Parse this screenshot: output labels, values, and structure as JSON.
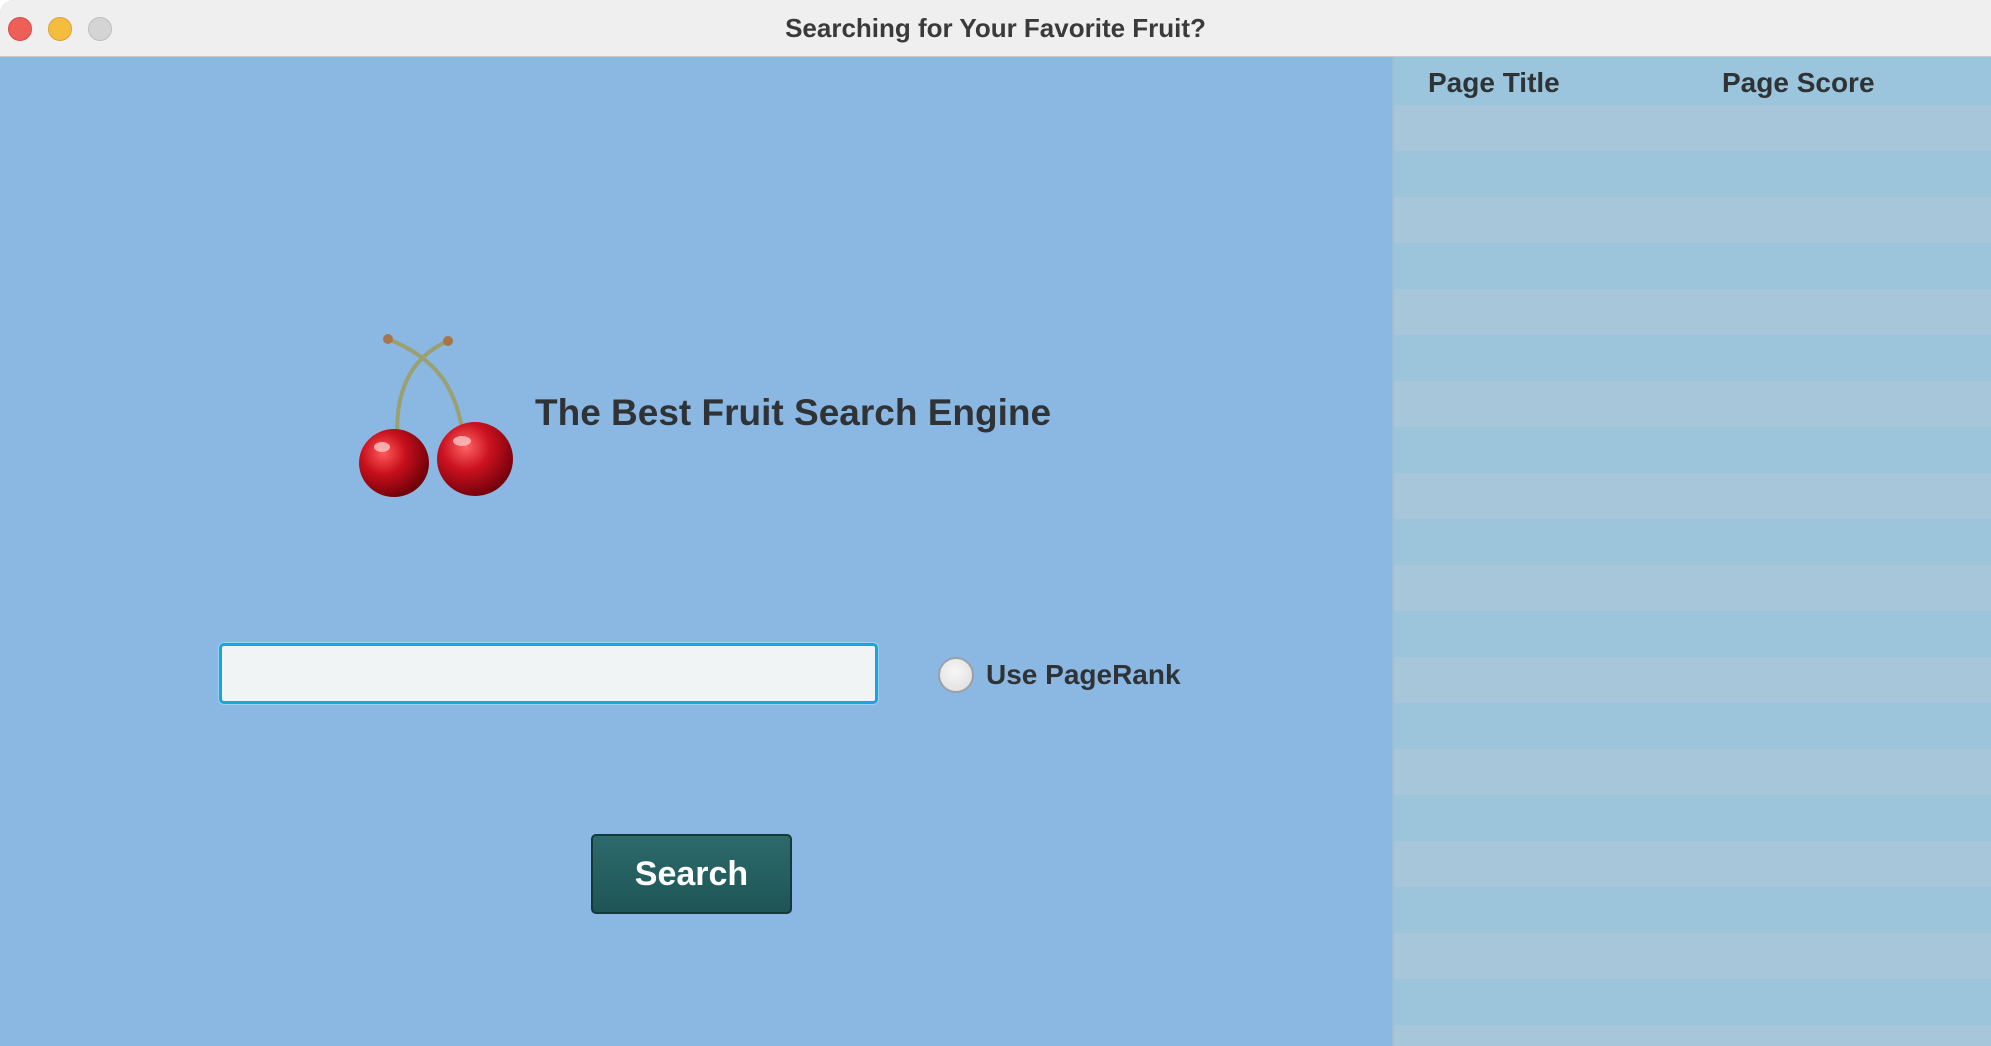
{
  "window": {
    "title": "Searching for Your Favorite Fruit?"
  },
  "main": {
    "logo_icon": "cherry-icon",
    "headline": "The Best Fruit Search Engine",
    "search": {
      "value": "",
      "placeholder": ""
    },
    "pagerank_option": {
      "label": "Use PageRank",
      "checked": false
    },
    "search_button_label": "Search"
  },
  "results_table": {
    "columns": [
      "Page Title",
      "Page Score"
    ],
    "rows": []
  },
  "colors": {
    "background": "#8bb8e2",
    "button": "#245f60",
    "input_focus": "#1aa3e0",
    "table_row_a": "#a7c6da",
    "table_row_b": "#9cc5db"
  }
}
